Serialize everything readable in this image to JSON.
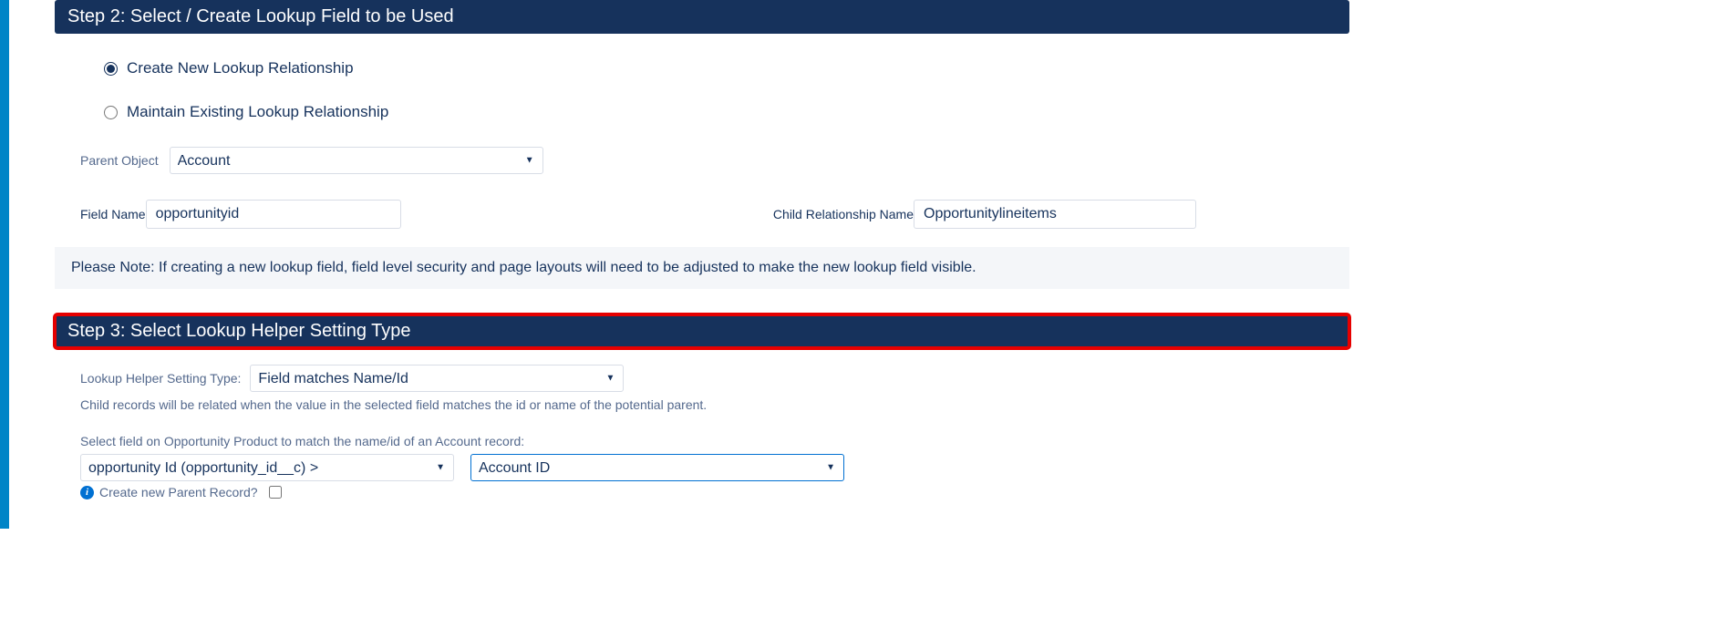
{
  "step2": {
    "header": "Step 2: Select / Create Lookup Field to be Used",
    "radio_create": "Create New Lookup Relationship",
    "radio_maintain": "Maintain Existing Lookup Relationship",
    "parent_object_label": "Parent Object",
    "parent_object_value": "Account",
    "field_name_label": "Field Name",
    "field_name_value": "opportunityid",
    "child_rel_label": "Child Relationship Name",
    "child_rel_value": "Opportunitylineitems",
    "note": "Please Note: If creating a new lookup field, field level security and page layouts will need to be adjusted to make the new lookup field visible."
  },
  "step3": {
    "header": "Step 3: Select Lookup Helper Setting Type",
    "setting_type_label": "Lookup Helper Setting Type:",
    "setting_type_value": "Field matches Name/Id",
    "help_text": "Child records will be related when the value in the selected field matches the id or name of the potential parent.",
    "select_field_label": "Select field on Opportunity Product to match the name/id of an Account record:",
    "match_field_1": "opportunity Id (opportunity_id__c) >",
    "match_field_2": "Account ID",
    "create_parent_label": "Create new Parent Record?"
  },
  "colors": {
    "header_bg": "#16325c",
    "highlight": "#e60000",
    "accent": "#0070d2"
  }
}
